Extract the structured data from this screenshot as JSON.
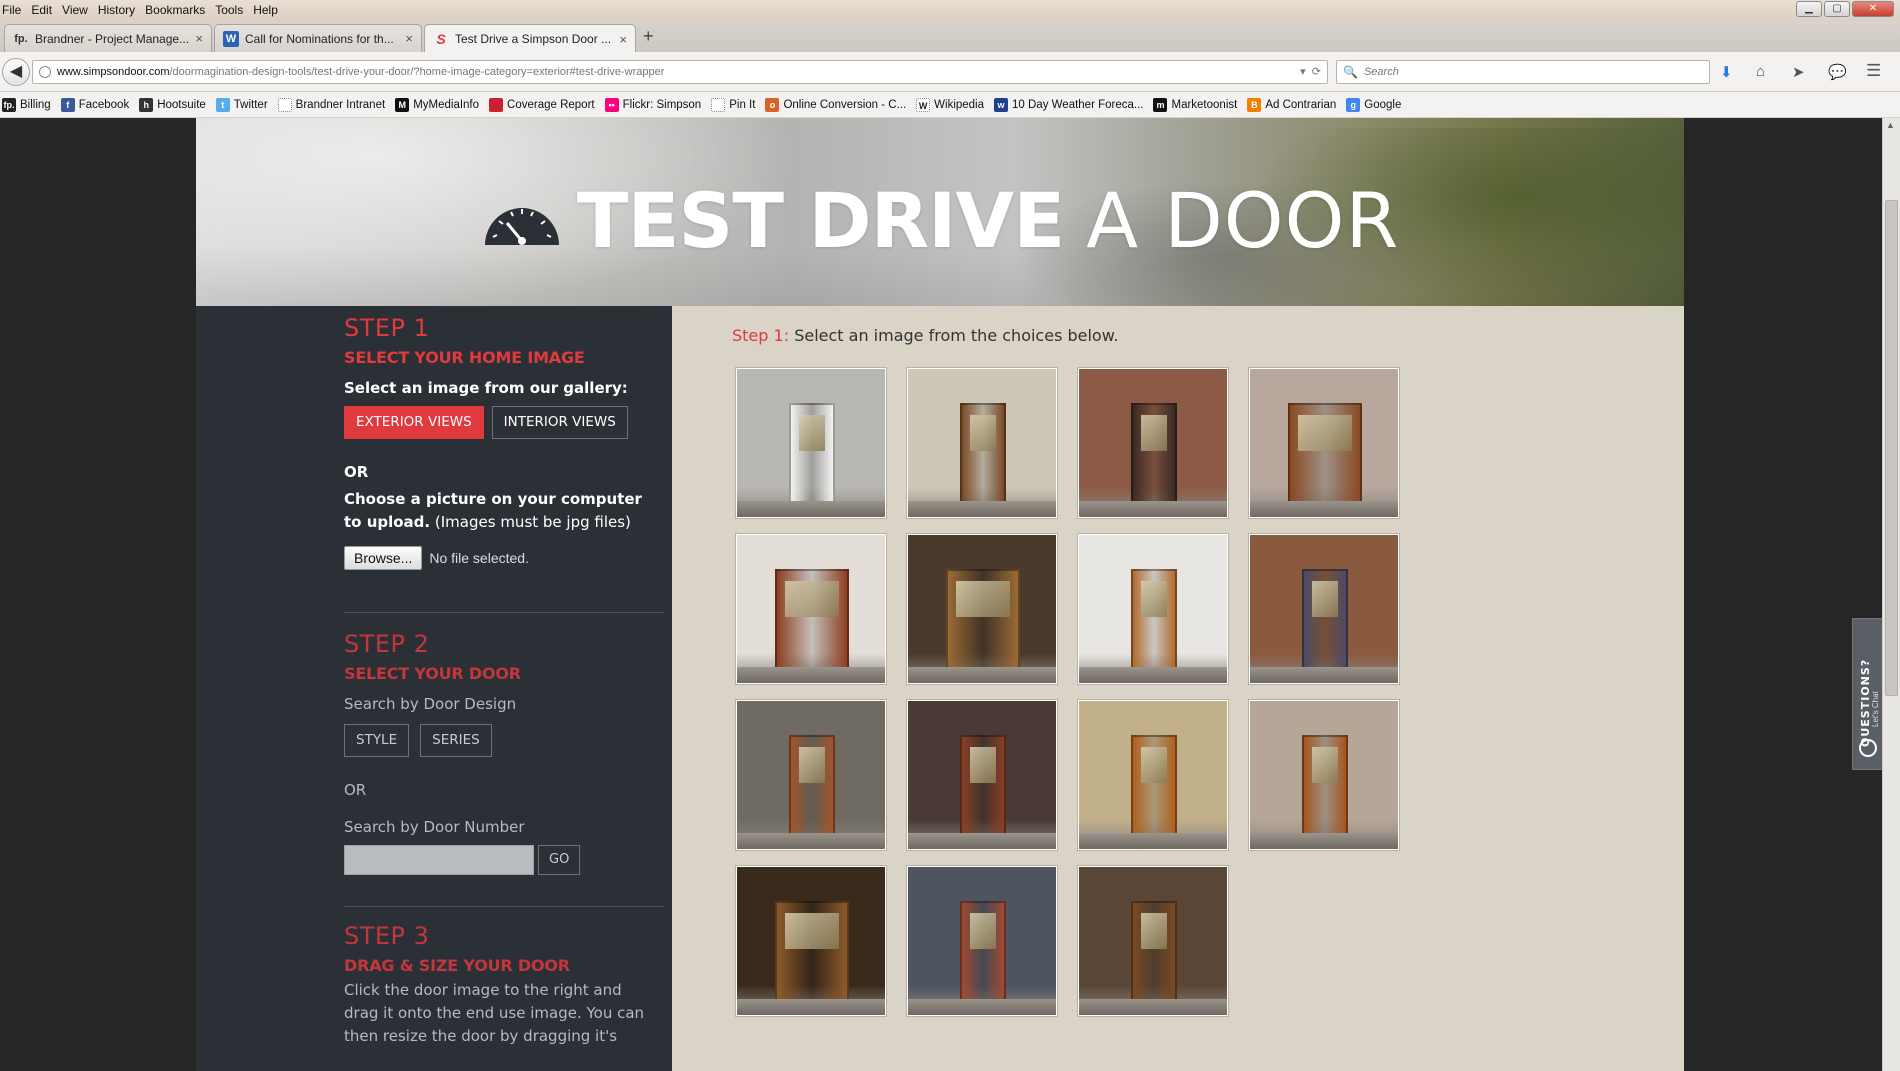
{
  "menu": [
    "File",
    "Edit",
    "View",
    "History",
    "Bookmarks",
    "Tools",
    "Help"
  ],
  "tabs": [
    {
      "icon": "fp.",
      "label": "Brandner - Project Manage...",
      "close": "×"
    },
    {
      "icon": "W",
      "label": "Call for Nominations for th...",
      "close": "×"
    },
    {
      "icon": "S",
      "label": "Test Drive a Simpson Door ...",
      "close": "×"
    }
  ],
  "new_tab": "+",
  "address": {
    "host": "www.simpsondoor.com",
    "path": "/doormagination-design-tools/test-drive-your-door/?home-image-category=exterior#test-drive-wrapper"
  },
  "search": {
    "placeholder": "Search"
  },
  "bookmarks": [
    {
      "label": "Billing",
      "icon": "fp.",
      "color": "#222222"
    },
    {
      "label": "Facebook",
      "icon": "f",
      "color": "#3b5998"
    },
    {
      "label": "Hootsuite",
      "icon": "h",
      "color": "#333333"
    },
    {
      "label": "Twitter",
      "icon": "t",
      "color": "#55acee"
    },
    {
      "label": "Brandner Intranet",
      "icon": "",
      "color": "#ffffff"
    },
    {
      "label": "MyMediaInfo",
      "icon": "M",
      "color": "#111111"
    },
    {
      "label": "Coverage Report",
      "icon": "",
      "color": "#cc1f2f"
    },
    {
      "label": "Flickr: Simpson",
      "icon": "••",
      "color": "#ff0084"
    },
    {
      "label": "Pin It",
      "icon": "",
      "color": "#ffffff"
    },
    {
      "label": "Online Conversion - C...",
      "icon": "o",
      "color": "#d9622b"
    },
    {
      "label": "Wikipedia",
      "icon": "W",
      "color": "#ffffff"
    },
    {
      "label": "10 Day Weather Foreca...",
      "icon": "w",
      "color": "#1f3f8f"
    },
    {
      "label": "Marketoonist",
      "icon": "m",
      "color": "#111111"
    },
    {
      "label": "Ad Contrarian",
      "icon": "B",
      "color": "#f57d00"
    },
    {
      "label": "Google",
      "icon": "g",
      "color": "#4285f4"
    }
  ],
  "hero": {
    "title_bold": "TEST DRIVE",
    "title_light": "A DOOR"
  },
  "sidebar": {
    "step1": {
      "title": "STEP 1",
      "subtitle": "SELECT YOUR HOME IMAGE",
      "prompt": "Select an image from our gallery:",
      "btn_exterior": "EXTERIOR VIEWS",
      "btn_interior": "INTERIOR VIEWS",
      "or": "OR",
      "upload_bold": "Choose a picture on your computer to upload.",
      "upload_note": "(Images must be jpg files)",
      "browse": "Browse...",
      "no_file": "No file selected."
    },
    "step2": {
      "title": "STEP 2",
      "subtitle": "SELECT YOUR DOOR",
      "search_design": "Search by Door Design",
      "btn_style": "STYLE",
      "btn_series": "SERIES",
      "or": "OR",
      "search_number": "Search by Door Number",
      "go": "GO"
    },
    "step3": {
      "title": "STEP 3",
      "subtitle": "DRAG & SIZE YOUR DOOR",
      "text": "Click the door image to the right and drag it onto the end use image. You can then resize the door by dragging it's"
    }
  },
  "content": {
    "step_label": "Step 1:",
    "instruction": "Select an image from the choices below."
  },
  "gallery": [
    {
      "name": "white door with sidelights, stone porch",
      "wall": "#b9b7b4",
      "door": "#f2f2f0"
    },
    {
      "name": "arched wood door, stone surround",
      "wall": "#cfc7b6",
      "door": "#7a4a26"
    },
    {
      "name": "dark door, brick wall",
      "wall": "#8d5b45",
      "door": "#3a2a24"
    },
    {
      "name": "double arched wood door",
      "wall": "#b7a79c",
      "door": "#8a4a22"
    },
    {
      "name": "double mahogany doors",
      "wall": "#e2ddd7",
      "door": "#8e3f23"
    },
    {
      "name": "double wood doors with glass",
      "wall": "#4a3a2c",
      "door": "#9a6a34"
    },
    {
      "name": "wood door with sidelight, red mat",
      "wall": "#e8e6e2",
      "door": "#b36a2c"
    },
    {
      "name": "purple door, shingle wall",
      "wall": "#8a5a3e",
      "door": "#4e4a66"
    },
    {
      "name": "arched door, stone entry",
      "wall": "#6f6a62",
      "door": "#a2552a"
    },
    {
      "name": "wood door, dark siding",
      "wall": "#4a3a36",
      "door": "#8a3f26"
    },
    {
      "name": "wood door, tan siding",
      "wall": "#c2b08a",
      "door": "#b0601e"
    },
    {
      "name": "wood door with sidelights and shrubs",
      "wall": "#b6a698",
      "door": "#a5561e"
    },
    {
      "name": "double rustic wood doors",
      "wall": "#3a2a1c",
      "door": "#8e5a2a"
    },
    {
      "name": "red-brown door, blue siding",
      "wall": "#4e5560",
      "door": "#a34a32"
    },
    {
      "name": "rustic wood door with sidelights",
      "wall": "#5a4636",
      "door": "#7a4a22"
    }
  ],
  "questions": {
    "label": "QUESTIONS?",
    "sub": "Let's Chat"
  },
  "colors": {
    "accent": "#e0393e",
    "sidebar": "#2b3036",
    "content_bg": "#d9d3c8"
  }
}
